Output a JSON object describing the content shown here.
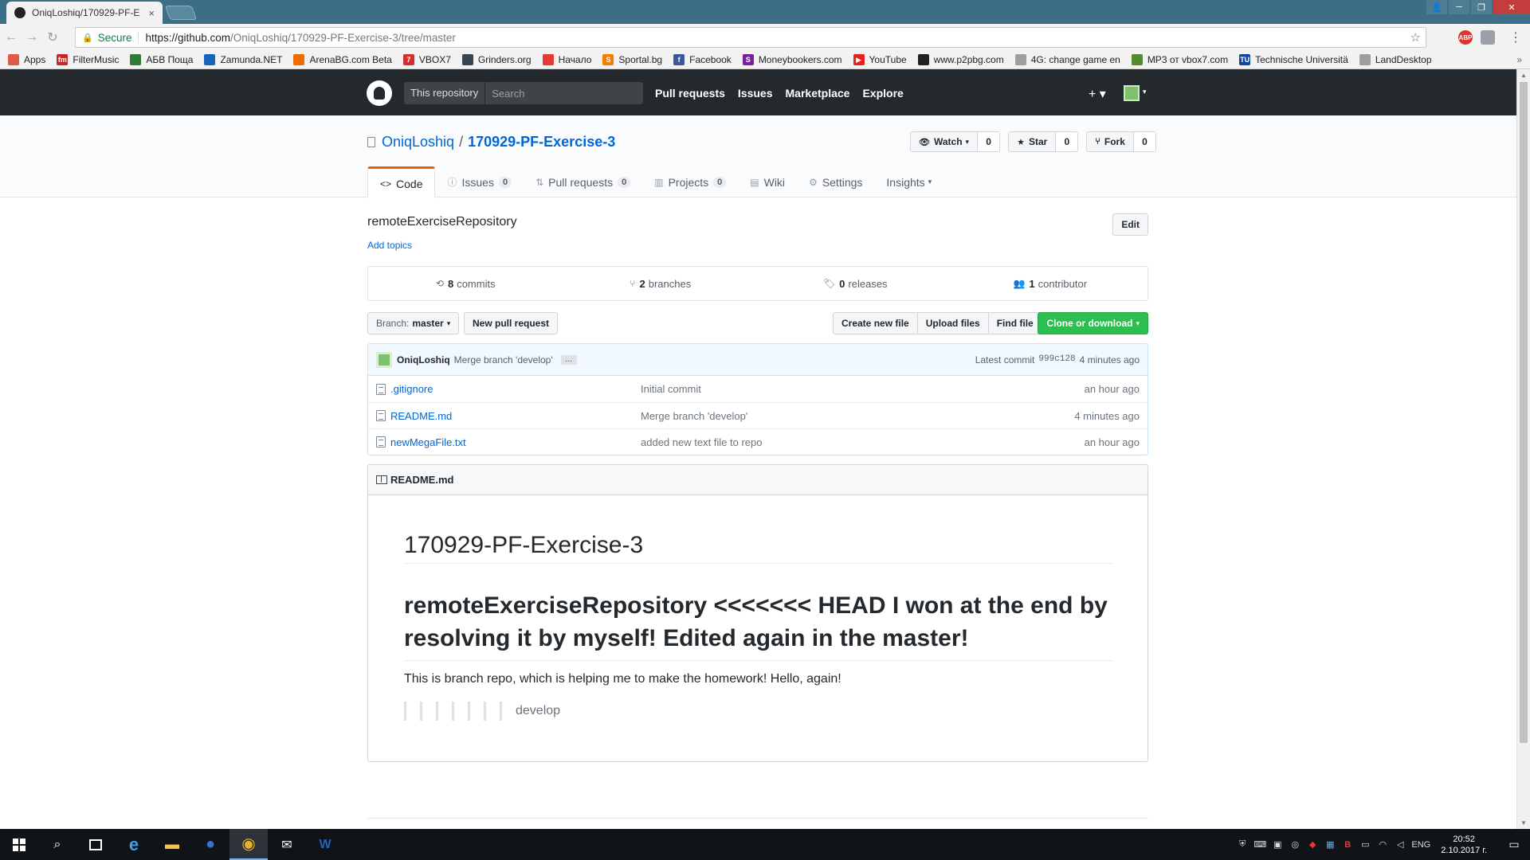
{
  "browser": {
    "tab_title": "OniqLoshiq/170929-PF-E",
    "tab_close": "×",
    "secure_label": "Secure",
    "url_host": "https://github.com",
    "url_path": "/OniqLoshiq/170929-PF-Exercise-3/tree/master",
    "ext_abp": "ABP",
    "bookmarks": [
      {
        "label": "Apps",
        "color": "#e05a47",
        "glyph": ""
      },
      {
        "label": "FilterMusic",
        "color": "#c62828",
        "glyph": "fm"
      },
      {
        "label": "АБВ Поща",
        "color": "#2e7d32",
        "glyph": ""
      },
      {
        "label": "Zamunda.NET",
        "color": "#1565c0",
        "glyph": ""
      },
      {
        "label": "ArenaBG.com Beta",
        "color": "#ef6c00",
        "glyph": ""
      },
      {
        "label": "VBOX7",
        "color": "#d32f2f",
        "glyph": "7"
      },
      {
        "label": "Grinders.org",
        "color": "#37474f",
        "glyph": ""
      },
      {
        "label": "Начало",
        "color": "#e53935",
        "glyph": ""
      },
      {
        "label": "Sportal.bg",
        "color": "#f57c00",
        "glyph": "S"
      },
      {
        "label": "Facebook",
        "color": "#3b5998",
        "glyph": "f"
      },
      {
        "label": "Moneybookers.com",
        "color": "#7b1fa2",
        "glyph": "S"
      },
      {
        "label": "YouTube",
        "color": "#e62117",
        "glyph": "▶"
      },
      {
        "label": "www.p2pbg.com",
        "color": "#212121",
        "glyph": ""
      },
      {
        "label": "4G: change game en",
        "color": "#9e9e9e",
        "glyph": ""
      },
      {
        "label": "MP3 от vbox7.com",
        "color": "#558b2f",
        "glyph": ""
      },
      {
        "label": "Technische Universitä",
        "color": "#0d47a1",
        "glyph": "TU"
      },
      {
        "label": "LandDesktop",
        "color": "#9e9e9e",
        "glyph": ""
      }
    ],
    "bookmarks_more": "»"
  },
  "gh": {
    "search_scope": "This repository",
    "search_placeholder": "Search",
    "nav": [
      "Pull requests",
      "Issues",
      "Marketplace",
      "Explore"
    ],
    "plus": "+ ▾",
    "avatar_caret": "▾"
  },
  "repo": {
    "owner": "OniqLoshiq",
    "separator": "/",
    "name": "170929-PF-Exercise-3",
    "watch_label": "Watch",
    "watch_count": "0",
    "star_label": "Star",
    "star_count": "0",
    "fork_label": "Fork",
    "fork_count": "0",
    "tabs": {
      "code": "Code",
      "issues": "Issues",
      "issues_count": "0",
      "pulls": "Pull requests",
      "pulls_count": "0",
      "projects": "Projects",
      "projects_count": "0",
      "wiki": "Wiki",
      "settings": "Settings",
      "insights": "Insights"
    },
    "description": "remoteExerciseRepository",
    "add_topics": "Add topics",
    "edit_label": "Edit",
    "summary": {
      "commits_num": "8",
      "commits_label": "commits",
      "branches_num": "2",
      "branches_label": "branches",
      "releases_num": "0",
      "releases_label": "releases",
      "contributors_num": "1",
      "contributors_label": "contributor"
    },
    "branch_prefix": "Branch:",
    "branch_name": "master",
    "new_pr": "New pull request",
    "create_file": "Create new file",
    "upload_files": "Upload files",
    "find_file": "Find file",
    "clone": "Clone or download",
    "latest_commit": {
      "author": "OniqLoshiq",
      "message": "Merge branch 'develop'",
      "ellipsis": "…",
      "prefix": "Latest commit",
      "sha": "999c128",
      "age": "4 minutes ago"
    },
    "files": [
      {
        "name": ".gitignore",
        "message": "Initial commit",
        "age": "an hour ago"
      },
      {
        "name": "README.md",
        "message": "Merge branch 'develop'",
        "age": "4 minutes ago"
      },
      {
        "name": "newMegaFile.txt",
        "message": "added new text file to repo",
        "age": "an hour ago"
      }
    ],
    "readme": {
      "filename": "README.md",
      "h1": "170929-PF-Exercise-3",
      "h2": "remoteExerciseRepository <<<<<<< HEAD I won at the end by resolving it by myself! Edited again in the master!",
      "paragraph": "This is branch repo, which is helping me to make the homework! Hello, again!",
      "quote": "develop"
    }
  },
  "taskbar": {
    "lang": "ENG",
    "time": "20:52",
    "date": "2.10.2017 г."
  }
}
